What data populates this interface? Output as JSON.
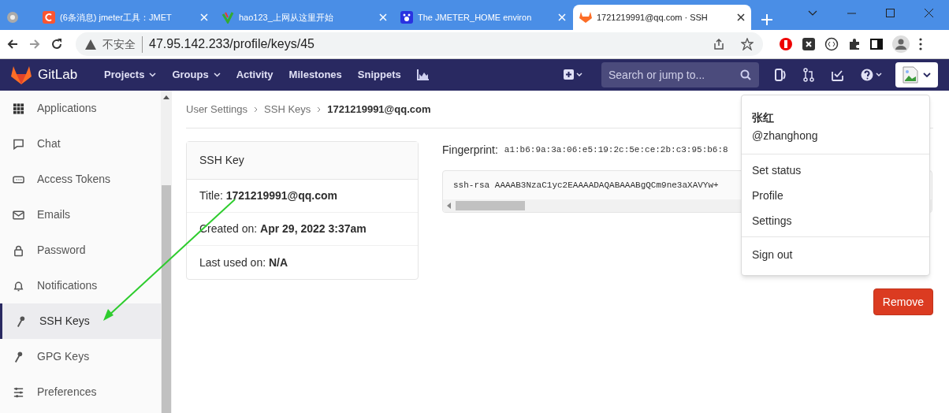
{
  "browser": {
    "tabs": [
      {
        "kind": "pinned",
        "selected": false
      },
      {
        "kind": "csdn",
        "title": "(6条消息) jmeter工具：JMET",
        "selected": false
      },
      {
        "kind": "hao",
        "title": "hao123_上网从这里开始",
        "selected": false
      },
      {
        "kind": "baidu",
        "title": "The JMETER_HOME environ",
        "selected": false
      },
      {
        "kind": "gitlab",
        "title": "1721219991@qq.com · SSH",
        "selected": true
      }
    ],
    "security": "不安全",
    "url": "47.95.142.233/profile/keys/45"
  },
  "navbar": {
    "brand": "GitLab",
    "links": [
      {
        "label": "Projects",
        "dropdown": true
      },
      {
        "label": "Groups",
        "dropdown": true
      },
      {
        "label": "Activity",
        "dropdown": false
      },
      {
        "label": "Milestones",
        "dropdown": false
      },
      {
        "label": "Snippets",
        "dropdown": false
      }
    ],
    "search": {
      "placeholder": "Search or jump to..."
    }
  },
  "sidebar": {
    "items": [
      {
        "kind": "apps",
        "label": "Applications",
        "selected": false
      },
      {
        "kind": "chat",
        "label": "Chat",
        "selected": false
      },
      {
        "kind": "token",
        "label": "Access Tokens",
        "selected": false
      },
      {
        "kind": "mail",
        "label": "Emails",
        "selected": false
      },
      {
        "kind": "lock",
        "label": "Password",
        "selected": false
      },
      {
        "kind": "bell",
        "label": "Notifications",
        "selected": false
      },
      {
        "kind": "key",
        "label": "SSH Keys",
        "selected": true
      },
      {
        "kind": "key",
        "label": "GPG Keys",
        "selected": false
      },
      {
        "kind": "prefs",
        "label": "Preferences",
        "selected": false
      }
    ]
  },
  "breadcrumbs": [
    "User Settings",
    "SSH Keys",
    "1721219991@qq.com"
  ],
  "key_card": {
    "heading": "SSH Key",
    "rows": [
      {
        "label": "Title:",
        "value": "1721219991@qq.com"
      },
      {
        "label": "Created on:",
        "value": "Apr 29, 2022 3:37am"
      },
      {
        "label": "Last used on:",
        "value": "N/A"
      }
    ]
  },
  "fingerprint": {
    "label": "Fingerprint:",
    "value": "a1:b6:9a:3a:06:e5:19:2c:5e:ce:2b:c3:95:b6:8"
  },
  "public_key": "ssh-rsa AAAAB3NzaC1yc2EAAAADAQABAAABgQCm9ne3aXAVYw+",
  "remove_button": "Remove",
  "user_menu": {
    "name": "张红",
    "username": "@zhanghong",
    "items": [
      {
        "label": "Set status",
        "separator_before": false
      },
      {
        "label": "Profile",
        "separator_before": false
      },
      {
        "label": "Settings",
        "separator_before": false
      },
      {
        "label": "Sign out",
        "separator_before": true
      }
    ]
  }
}
